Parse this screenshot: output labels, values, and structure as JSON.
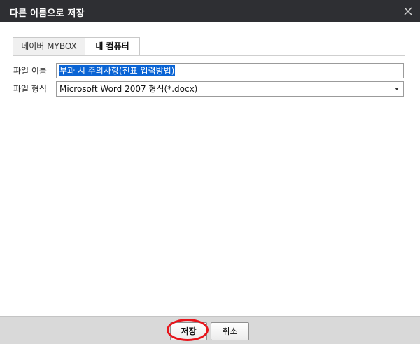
{
  "dialog": {
    "title": "다른 이름으로 저장",
    "close_icon": "close-icon"
  },
  "tabs": [
    {
      "label": "네이버 MYBOX",
      "active": false
    },
    {
      "label": "내 컴퓨터",
      "active": true
    }
  ],
  "form": {
    "filename_label": "파일 이름",
    "filename_value": "부과 시 주의사항(전표 입력방법)",
    "filetype_label": "파일 형식",
    "filetype_value": "Microsoft Word 2007 형식(*.docx)"
  },
  "buttons": {
    "save_label": "저장",
    "cancel_label": "취소"
  },
  "colors": {
    "titlebar": "#2e2f33",
    "selection": "#0a64d4",
    "highlight": "#e8141b"
  }
}
